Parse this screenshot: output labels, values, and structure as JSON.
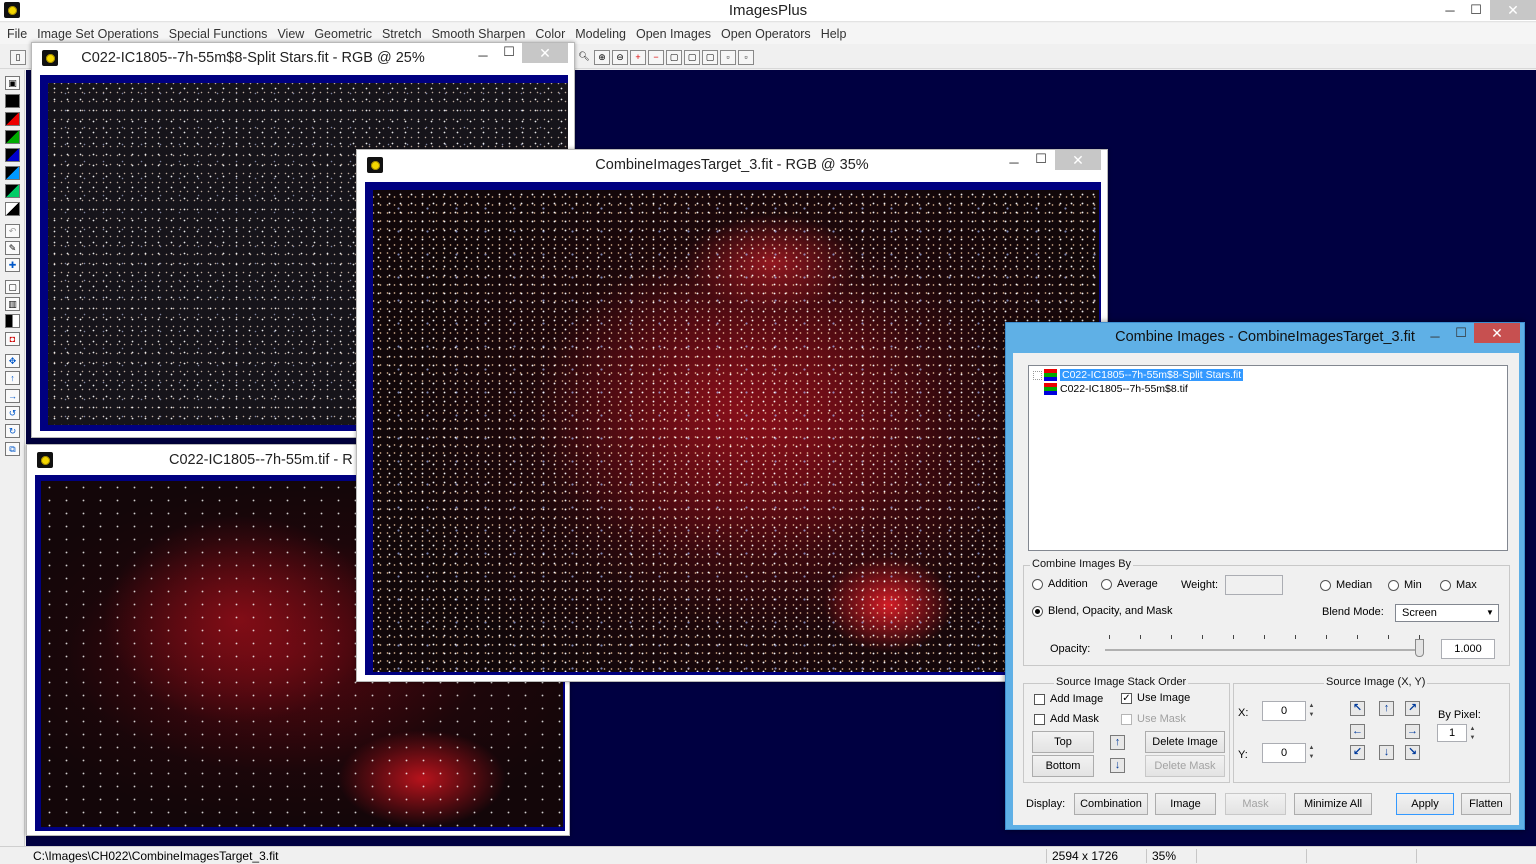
{
  "app": {
    "title": "ImagesPlus"
  },
  "menu": [
    "File",
    "Image Set Operations",
    "Special Functions",
    "View",
    "Geometric",
    "Stretch",
    "Smooth Sharpen",
    "Color",
    "Modeling",
    "Open Images",
    "Open Operators",
    "Help"
  ],
  "windows": {
    "split_stars": {
      "title": "C022-IC1805--7h-55m$8-Split Stars.fit - RGB @ 25%"
    },
    "tif": {
      "title": "C022-IC1805--7h-55m.tif - R"
    },
    "target": {
      "title": "CombineImagesTarget_3.fit - RGB @ 35%"
    }
  },
  "dialog": {
    "title": "Combine Images - CombineImagesTarget_3.fit",
    "image_list": [
      {
        "name": "C022-IC1805--7h-55m$8-Split Stars.fit",
        "selected": true
      },
      {
        "name": "C022-IC1805--7h-55m$8.tif",
        "selected": false
      }
    ],
    "combine_by": {
      "label": "Combine Images By",
      "addition": "Addition",
      "average": "Average",
      "weight_label": "Weight:",
      "median": "Median",
      "min": "Min",
      "max": "Max",
      "blend": "Blend, Opacity, and Mask",
      "blend_mode_label": "Blend Mode:",
      "blend_mode_value": "Screen",
      "opacity_label": "Opacity:",
      "opacity_value": "1.000",
      "opacity_fraction": 1.0
    },
    "stack_order": {
      "label": "Source Image Stack Order",
      "add_image": "Add Image",
      "use_image": "Use Image",
      "add_mask": "Add Mask",
      "use_mask": "Use Mask",
      "top": "Top",
      "bottom": "Bottom",
      "delete_image": "Delete Image",
      "delete_mask": "Delete Mask"
    },
    "source_xy": {
      "label": "Source Image (X, Y)",
      "x_label": "X:",
      "x_value": "0",
      "y_label": "Y:",
      "y_value": "0",
      "by_pixel_label": "By Pixel:",
      "by_pixel_value": "1"
    },
    "display": {
      "label": "Display:",
      "combination": "Combination",
      "image": "Image",
      "mask": "Mask",
      "minimize_all": "Minimize All",
      "apply": "Apply",
      "flatten": "Flatten"
    }
  },
  "status": {
    "path": "C:\\Images\\CH022\\CombineImagesTarget_3.fit",
    "dimensions": "2594 x 1726",
    "zoom": "35%"
  },
  "colors": {
    "mdi_background": "#000041",
    "image_frame": "#000080",
    "dialog_frame": "#5fb0e6",
    "close_button": "#c75050",
    "selection": "#3399ff"
  }
}
